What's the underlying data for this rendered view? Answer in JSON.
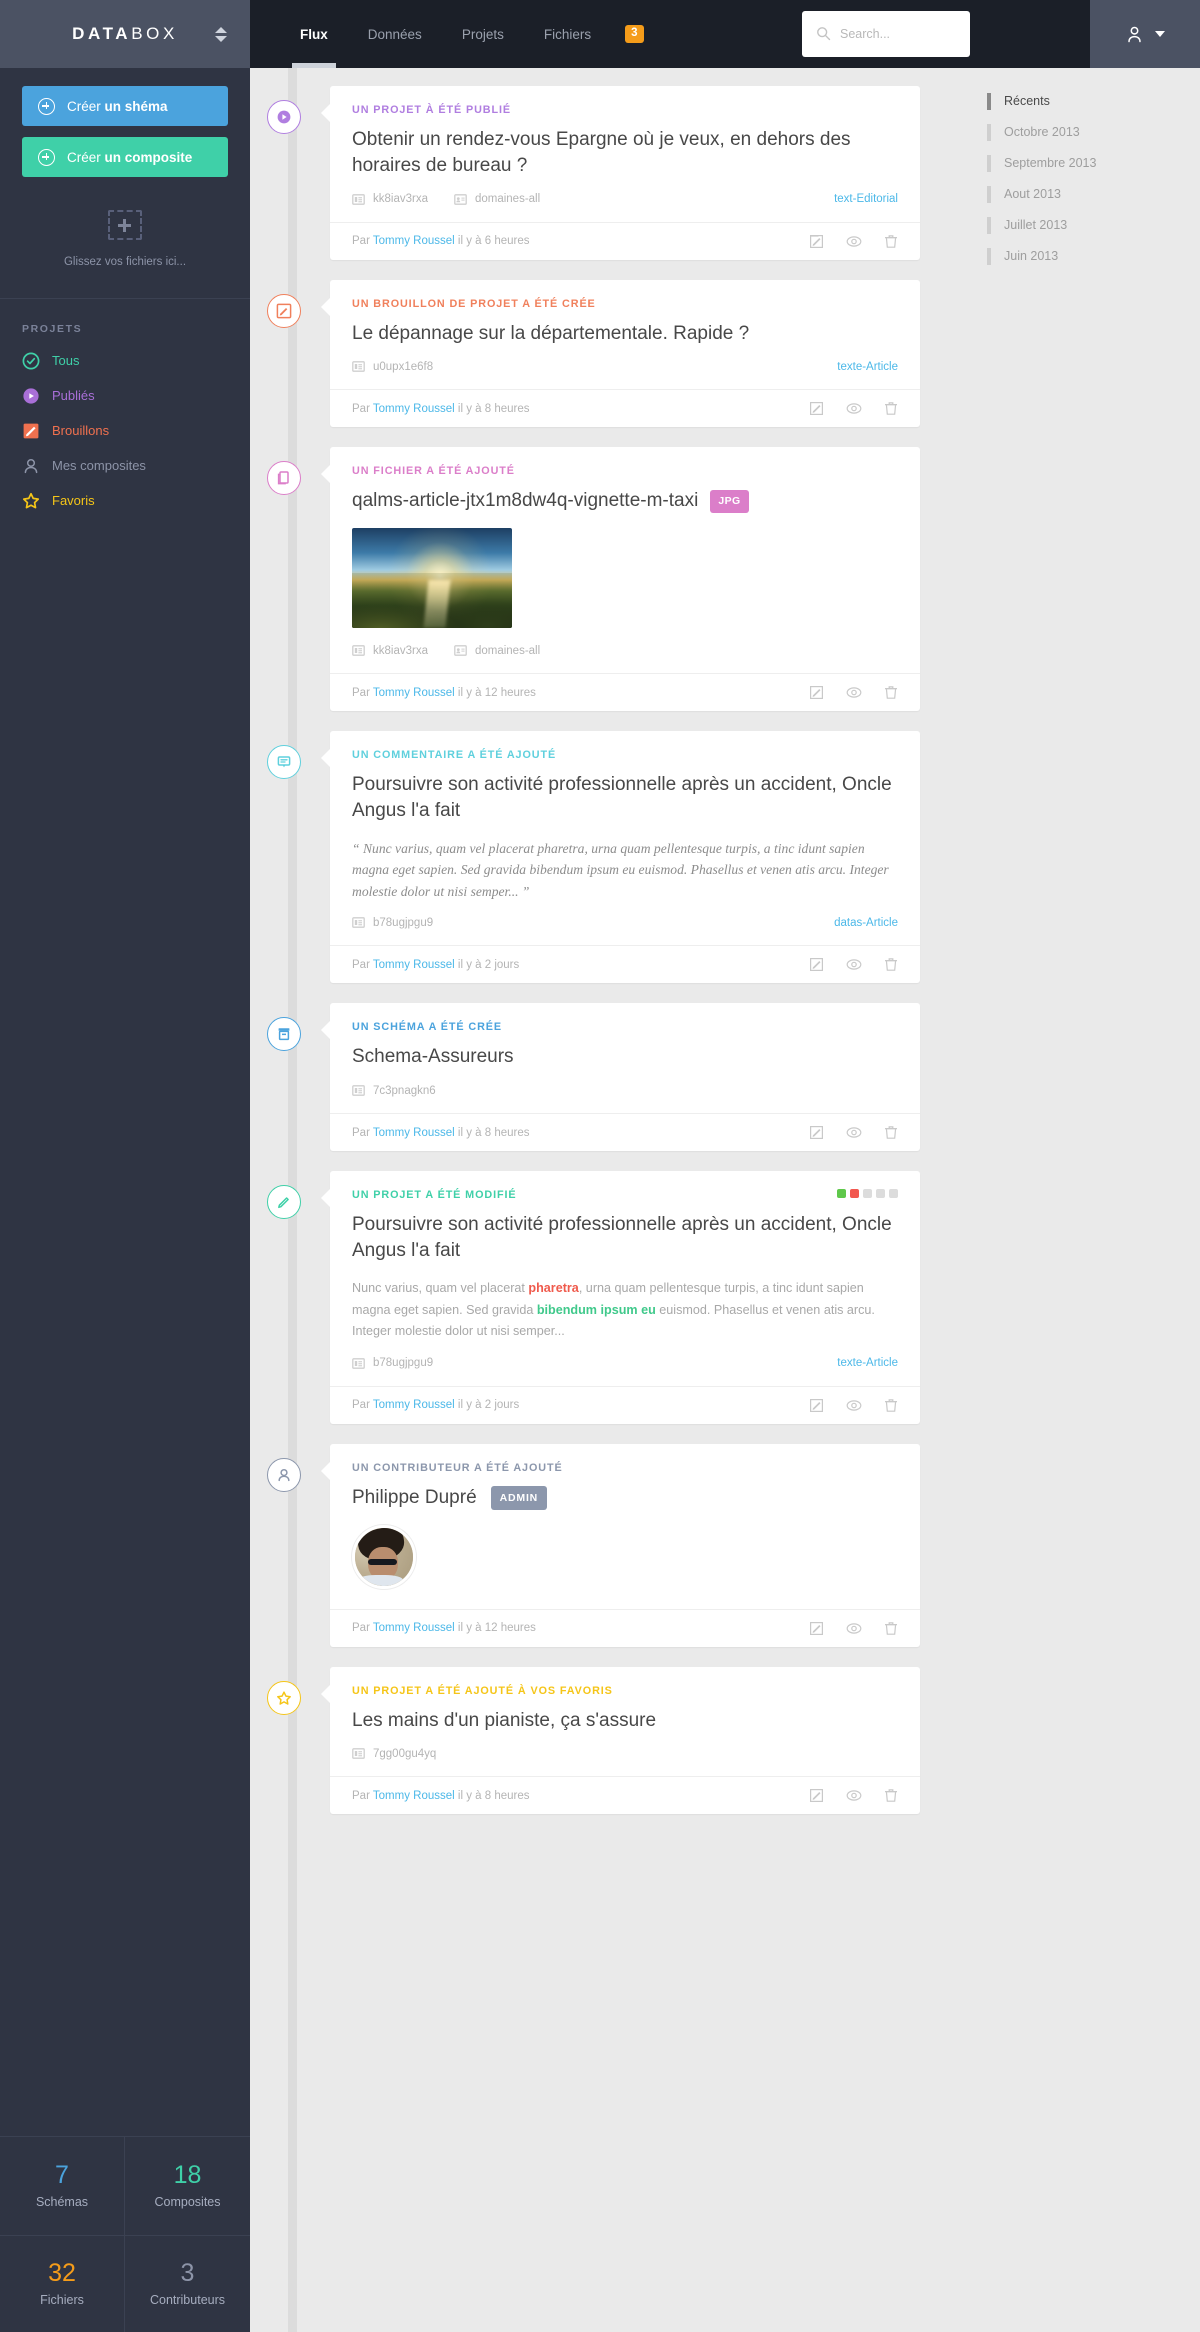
{
  "brand": {
    "name_bold": "DATA",
    "name_light": "BOX",
    "toggle_icon": "sort-chevrons-icon"
  },
  "sidebar": {
    "create_schema": {
      "prefix": "Créer ",
      "strong": "un shéma"
    },
    "create_composite": {
      "prefix": "Créer ",
      "strong": "un composite"
    },
    "dropzone_text": "Glissez vos fichiers ici...",
    "section_title": "PROJETS",
    "items": [
      {
        "label": "Tous",
        "icon": "check-circle-icon",
        "color": "#3fd0a8"
      },
      {
        "label": "Publiés",
        "icon": "play-circle-icon",
        "color": "#a96fd8"
      },
      {
        "label": "Brouillons",
        "icon": "pencil-square-icon",
        "color": "#f0714f"
      },
      {
        "label": "Mes composites",
        "icon": "user-icon",
        "color": "#8d94a8"
      },
      {
        "label": "Favoris",
        "icon": "star-icon",
        "color": "#f5c518"
      }
    ],
    "stats": [
      {
        "value": "7",
        "label": "Schémas",
        "color": "#4ba3dd"
      },
      {
        "value": "18",
        "label": "Composites",
        "color": "#3fd0a8"
      },
      {
        "value": "32",
        "label": "Fichiers",
        "color": "#f59c1a"
      },
      {
        "value": "3",
        "label": "Contributeurs",
        "color": "#8d94a8"
      }
    ]
  },
  "topbar": {
    "tabs": [
      {
        "label": "Flux",
        "active": true
      },
      {
        "label": "Données",
        "active": false
      },
      {
        "label": "Projets",
        "active": false
      },
      {
        "label": "Fichiers",
        "active": false
      }
    ],
    "badge": "3",
    "search_placeholder": "Search...",
    "search_value": "",
    "search_icon": "search-icon",
    "user_icon": "user-icon",
    "chevron_icon": "chevron-down-icon"
  },
  "rail": {
    "items": [
      {
        "label": "Récents",
        "active": true
      },
      {
        "label": "Octobre 2013",
        "active": false
      },
      {
        "label": "Septembre 2013",
        "active": false
      },
      {
        "label": "Aout 2013",
        "active": false
      },
      {
        "label": "Juillet 2013",
        "active": false
      },
      {
        "label": "Juin 2013",
        "active": false
      }
    ]
  },
  "feed": {
    "footer_prefix": "Par ",
    "action_icons": [
      "edit-icon",
      "eye-icon",
      "trash-icon"
    ],
    "events": [
      {
        "type": "published",
        "badge_icon": "play-circle-icon",
        "accent": "#b07ee0",
        "kicker": "UN PROJET À ÉTÉ PUBLIÉ",
        "title": "Obtenir un rendez-vous Epargne où je veux, en dehors des horaires de bureau ?",
        "metas": [
          {
            "icon": "id-card-icon",
            "text": "kk8iav3rxa"
          },
          {
            "icon": "contact-card-icon",
            "text": "domaines-all"
          }
        ],
        "tag": "text-Editorial",
        "author": "Tommy Roussel",
        "time": "il y à 6 heures"
      },
      {
        "type": "draft",
        "badge_icon": "pencil-square-icon",
        "accent": "#f0805c",
        "kicker": "UN BROUILLON DE PROJET A ÉTÉ CRÉE",
        "title": "Le dépannage sur la départementale. Rapide ?",
        "metas": [
          {
            "icon": "id-card-icon",
            "text": "u0upx1e6f8"
          }
        ],
        "tag": "texte-Article",
        "author": "Tommy Roussel",
        "time": "il y à 8 heures"
      },
      {
        "type": "file",
        "badge_icon": "copy-file-icon",
        "accent": "#db7ec9",
        "kicker": "UN FICHIER A ÉTÉ AJOUTÉ",
        "title": "qalms-article-jtx1m8dw4q-vignette-m-taxi",
        "filetag": "JPG",
        "thumbnail": "mountain-sunset-photo",
        "metas": [
          {
            "icon": "id-card-icon",
            "text": "kk8iav3rxa"
          },
          {
            "icon": "contact-card-icon",
            "text": "domaines-all"
          }
        ],
        "author": "Tommy Roussel",
        "time": "il y à 12 heures"
      },
      {
        "type": "comment",
        "badge_icon": "comment-icon",
        "accent": "#5fd0dd",
        "kicker": "UN COMMENTAIRE A ÉTÉ AJOUTÉ",
        "title": "Poursuivre son activité professionnelle après un accident, Oncle Angus l'a fait",
        "quote": "“ Nunc varius, quam vel placerat pharetra, urna quam pellentesque turpis, a tinc idunt sapien magna eget sapien. Sed gravida bibendum ipsum eu euismod. Phasellus et venen atis arcu. Integer molestie dolor ut nisi semper... ”",
        "metas": [
          {
            "icon": "id-card-icon",
            "text": "b78ugjpgu9"
          }
        ],
        "tag": "datas-Article",
        "author": "Tommy Roussel",
        "time": "il y à 2 jours"
      },
      {
        "type": "schema",
        "badge_icon": "archive-box-icon",
        "accent": "#4ba3dd",
        "kicker": "UN SCHÉMA A ÉTÉ CRÉE",
        "title": "Schema-Assureurs",
        "metas": [
          {
            "icon": "id-card-icon",
            "text": "7c3pnagkn6"
          }
        ],
        "author": "Tommy Roussel",
        "time": "il y à 8 heures"
      },
      {
        "type": "modified",
        "badge_icon": "pencil-icon",
        "accent": "#3fd0a8",
        "kicker": "UN PROJET A ÉTÉ MODIFIÉ",
        "title": "Poursuivre son activité professionnelle après un accident, Oncle Angus l'a fait",
        "dots": [
          "#5fc84b",
          "#f2584f",
          "#dcdcdc",
          "#dcdcdc",
          "#dcdcdc"
        ],
        "excerpt_parts": [
          {
            "text": "Nunc varius, quam vel placerat ",
            "style": "plain"
          },
          {
            "text": "pharetra",
            "style": "red"
          },
          {
            "text": ", urna quam pellentesque turpis, a tinc idunt sapien magna eget sapien. Sed gravida ",
            "style": "plain"
          },
          {
            "text": "bibendum ipsum eu",
            "style": "green"
          },
          {
            "text": " euismod. Phasellus et venen atis arcu. Integer molestie dolor ut nisi semper...",
            "style": "plain"
          }
        ],
        "metas": [
          {
            "icon": "id-card-icon",
            "text": "b78ugjpgu9"
          }
        ],
        "tag": "texte-Article",
        "author": "Tommy Roussel",
        "time": "il y à 2 jours"
      },
      {
        "type": "contributor",
        "badge_icon": "user-icon",
        "accent": "#8c97ac",
        "kicker": "UN CONTRIBUTEUR A ÉTÉ AJOUTÉ",
        "title": "Philippe Dupré",
        "admin_tag": "ADMIN",
        "avatar": "photo-man-sunglasses",
        "author": "Tommy Roussel",
        "time": "il y à 12 heures"
      },
      {
        "type": "favorite",
        "badge_icon": "star-icon",
        "accent": "#f5c518",
        "kicker": "UN PROJET A ÉTÉ AJOUTÉ À VOS FAVORIS",
        "title": "Les mains d'un pianiste, ça s'assure",
        "metas": [
          {
            "icon": "id-card-icon",
            "text": "7gg00gu4yq"
          }
        ],
        "author": "Tommy Roussel",
        "time": "il y à 8 heures"
      }
    ]
  }
}
